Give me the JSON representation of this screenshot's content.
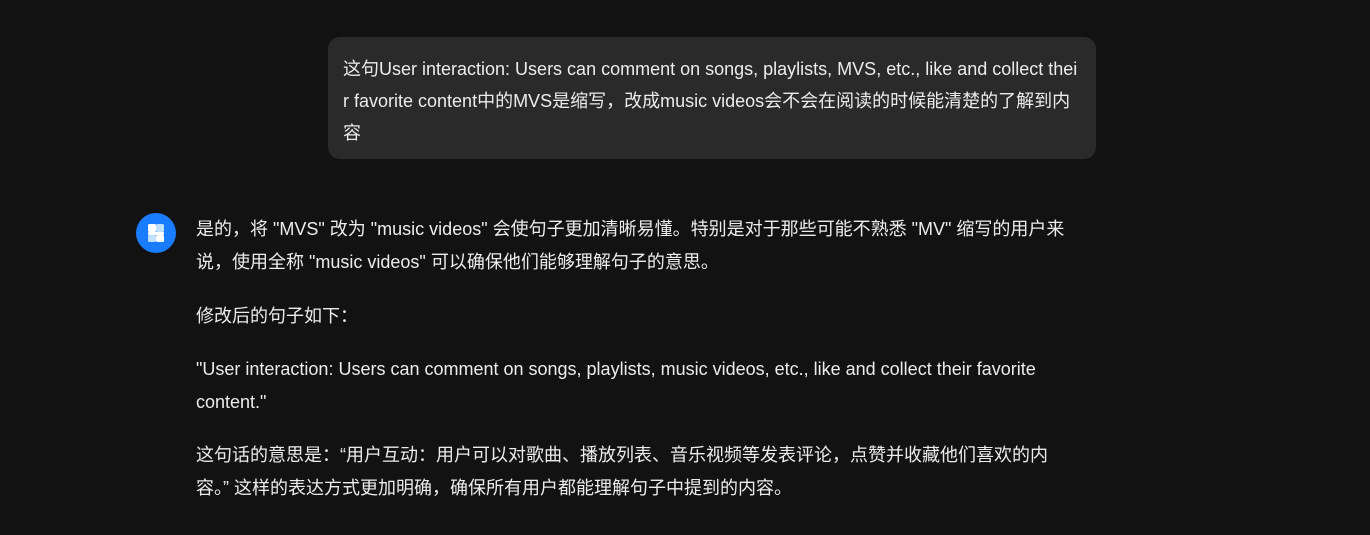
{
  "user_message": {
    "text": "这句User interaction: Users can comment on songs, playlists, MVS, etc., like and collect their favorite content中的MVS是缩写，改成music videos会不会在阅读的时候能清楚的了解到内容"
  },
  "assistant": {
    "avatar_icon": "assistant-logo-icon",
    "paragraphs": [
      "是的，将 \"MVS\" 改为 \"music videos\" 会使句子更加清晰易懂。特别是对于那些可能不熟悉 \"MV\" 缩写的用户来说，使用全称 \"music videos\" 可以确保他们能够理解句子的意思。",
      "修改后的句子如下：",
      "\"User interaction: Users can comment on songs, playlists, music videos, etc., like and collect their favorite content.\"",
      "这句话的意思是：“用户互动：用户可以对歌曲、播放列表、音乐视频等发表评论，点赞并收藏他们喜欢的内容。” 这样的表达方式更加明确，确保所有用户都能理解句子中提到的内容。"
    ]
  },
  "colors": {
    "background": "#121212",
    "user_bubble": "#2a2a2a",
    "avatar": "#1a7cff",
    "text": "#ececec"
  }
}
